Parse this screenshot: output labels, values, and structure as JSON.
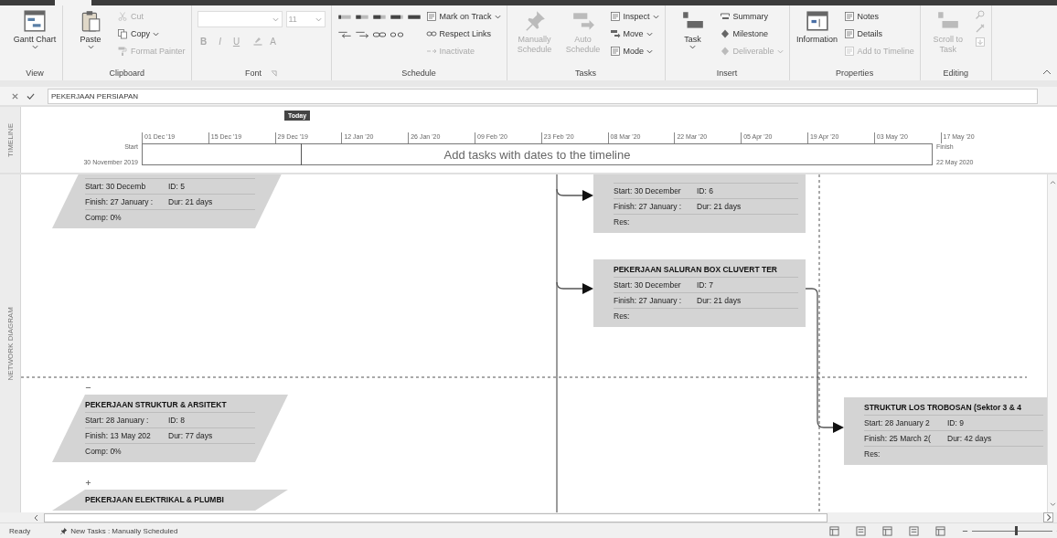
{
  "ribbon": {
    "groups": [
      {
        "kind": "standard",
        "label": "View",
        "commands": [
          {
            "kind": "large",
            "label": "Gantt Chart",
            "dropdown": true,
            "disabled": false
          }
        ]
      },
      {
        "kind": "standard",
        "label": "Clipboard",
        "commands": [
          {
            "kind": "large",
            "label": "Paste",
            "dropdown": true,
            "disabled": false
          },
          {
            "kind": "small",
            "label": "Cut",
            "dropdown": false,
            "disabled": true
          },
          {
            "kind": "small",
            "label": "Copy",
            "dropdown": true,
            "disabled": false
          },
          {
            "kind": "small",
            "label": "Format Painter",
            "dropdown": false,
            "disabled": true
          }
        ]
      },
      {
        "kind": "font",
        "label": "Font",
        "size": "11",
        "format_buttons": [
          {
            "label": "B",
            "disabled": true
          },
          {
            "label": "I",
            "disabled": true
          },
          {
            "label": "U",
            "disabled": true
          }
        ],
        "color_button": {
          "label": "A",
          "disabled": true
        }
      },
      {
        "kind": "standard",
        "label": "Schedule",
        "commands": [
          {
            "kind": "icon_grid"
          },
          {
            "kind": "small",
            "label": "Mark on Track",
            "dropdown": true,
            "disabled": false
          },
          {
            "kind": "small",
            "label": "Respect Links",
            "dropdown": false,
            "disabled": false
          },
          {
            "kind": "small",
            "label": "Inactivate",
            "dropdown": false,
            "disabled": true
          }
        ]
      },
      {
        "kind": "standard",
        "label": "Tasks",
        "commands": [
          {
            "kind": "large",
            "label": "Manually Schedule",
            "dropdown": false,
            "disabled": true
          },
          {
            "kind": "large",
            "label": "Auto Schedule",
            "dropdown": false,
            "disabled": true
          },
          {
            "kind": "small",
            "label": "Inspect",
            "dropdown": true,
            "disabled": false
          },
          {
            "kind": "small",
            "label": "Move",
            "dropdown": true,
            "disabled": false
          },
          {
            "kind": "small",
            "label": "Mode",
            "dropdown": true,
            "disabled": false
          }
        ]
      },
      {
        "kind": "standard",
        "label": "Insert",
        "commands": [
          {
            "kind": "large",
            "label": "Task",
            "dropdown": true,
            "disabled": false
          },
          {
            "kind": "small",
            "label": "Summary",
            "dropdown": false,
            "disabled": false
          },
          {
            "kind": "small",
            "label": "Milestone",
            "dropdown": false,
            "disabled": false
          },
          {
            "kind": "small",
            "label": "Deliverable",
            "dropdown": true,
            "disabled": true
          }
        ]
      },
      {
        "kind": "standard",
        "label": "Properties",
        "commands": [
          {
            "kind": "large",
            "label": "Information",
            "dropdown": false,
            "disabled": false
          },
          {
            "kind": "small",
            "label": "Notes",
            "dropdown": false,
            "disabled": false
          },
          {
            "kind": "small",
            "label": "Details",
            "dropdown": false,
            "disabled": false
          },
          {
            "kind": "small",
            "label": "Add to Timeline",
            "dropdown": false,
            "disabled": true
          }
        ]
      },
      {
        "kind": "standard",
        "label": "Editing",
        "commands": [
          {
            "kind": "large",
            "label": "Scroll to Task",
            "dropdown": false,
            "disabled": true
          },
          {
            "kind": "icon_column"
          }
        ]
      }
    ]
  },
  "entry_bar": {
    "value": "PEKERJAAN PERSIAPAN"
  },
  "timeline": {
    "side_label": "TIMELINE",
    "today": "Today",
    "ticks": [
      "01 Dec '19",
      "15 Dec '19",
      "29 Dec '19",
      "12 Jan '20",
      "26 Jan '20",
      "09 Feb '20",
      "23 Feb '20",
      "08 Mar '20",
      "22 Mar '20",
      "05 Apr '20",
      "19 Apr '20",
      "03 May '20",
      "17 May '20"
    ],
    "start": {
      "label": "Start",
      "date": "30 November 2019"
    },
    "finish": {
      "label": "Finish",
      "date": "22 May 2020"
    },
    "hint": "Add tasks with dates to the timeline"
  },
  "network_diagram": {
    "side_label": "NETWORK DIAGRAM",
    "nodes": [
      {
        "kind": "manual",
        "rows": [
          [
            "Start:  30 Decemb",
            "ID:  5"
          ],
          [
            "Finish: 27 January :",
            "Dur: 21 days"
          ],
          [
            "Comp: 0%"
          ]
        ]
      },
      {
        "kind": "auto",
        "rows": [
          [
            "Start:  30 December",
            "ID:  6"
          ],
          [
            "Finish: 27 January :",
            "Dur: 21 days"
          ],
          [
            "Res:"
          ]
        ]
      },
      {
        "kind": "auto",
        "title": "PEKERJAAN SALURAN BOX CLUVERT TER",
        "rows": [
          [
            "Start:  30 December",
            "ID:  7"
          ],
          [
            "Finish: 27 January :",
            "Dur: 21 days"
          ],
          [
            "Res:"
          ]
        ]
      },
      {
        "kind": "manual",
        "title": "PEKERJAAN STRUKTUR & ARSITEKT",
        "expanded": true,
        "rows": [
          [
            "Start:  28 January :",
            "ID:  8"
          ],
          [
            "Finish: 13 May 202",
            "Dur: 77 days"
          ],
          [
            "Comp: 0%"
          ]
        ]
      },
      {
        "kind": "manual",
        "title": "PEKERJAAN ELEKTRIKAL & PLUMBI",
        "expanded": false
      },
      {
        "kind": "auto",
        "title": "STRUKTUR LOS TROBOSAN (Sektor 3 & 4",
        "rows": [
          [
            "Start:  28 January 2",
            "ID:  9"
          ],
          [
            "Finish: 25 March 2(",
            "Dur: 42 days"
          ],
          [
            "Res:"
          ]
        ]
      }
    ]
  },
  "status_bar": {
    "state": "Ready",
    "new_tasks": "New Tasks : Manually Scheduled",
    "zoom": {
      "level": 0.55
    }
  }
}
